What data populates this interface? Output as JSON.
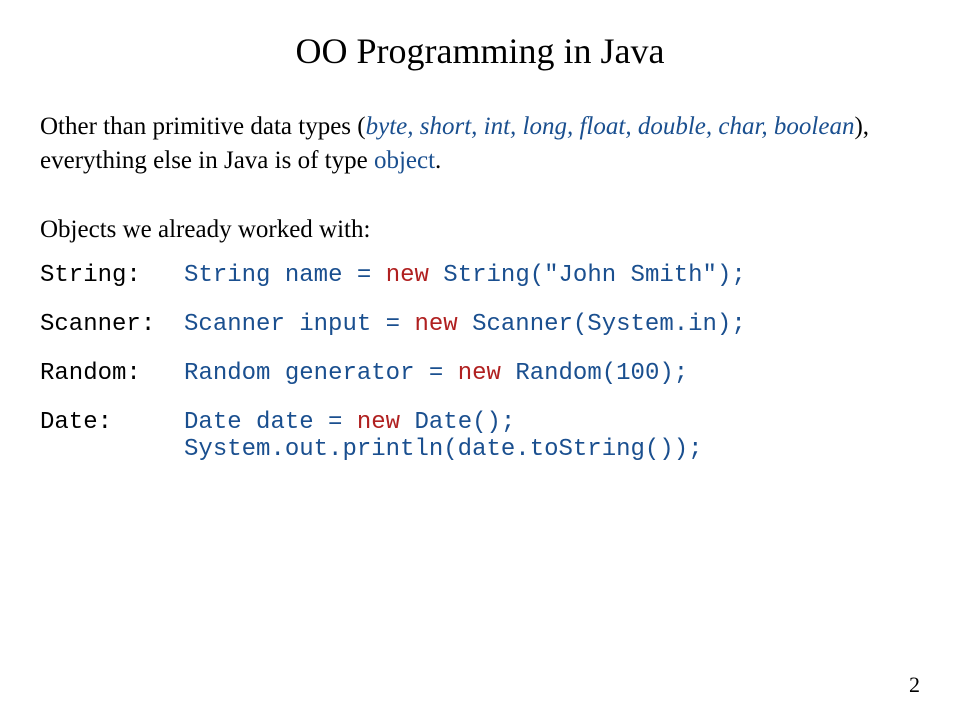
{
  "title": "OO Programming in Java",
  "intro": {
    "pre": "Other than primitive data types (",
    "types": "byte, short, int, long, float, double, char, boolean",
    "mid": "), everything else in Java is of type ",
    "obj": "object",
    "post": "."
  },
  "subhead": "Objects we already worked with:",
  "rows": {
    "string": {
      "label": "String:",
      "code_pre": "String name = ",
      "kw": "new",
      "code_post": " String(\"John Smith\");"
    },
    "scanner": {
      "label": "Scanner:",
      "code_pre": "Scanner input = ",
      "kw": "new",
      "code_post": " Scanner(System.in);"
    },
    "random": {
      "label": "Random:",
      "code_pre": "Random generator = ",
      "kw": "new",
      "code_post": " Random(100);"
    },
    "date": {
      "label": "Date:",
      "code_pre": "Date date = ",
      "kw": "new",
      "code_post": " Date();",
      "line2": "System.out.println(date.toString());"
    }
  },
  "pagenum": "2"
}
